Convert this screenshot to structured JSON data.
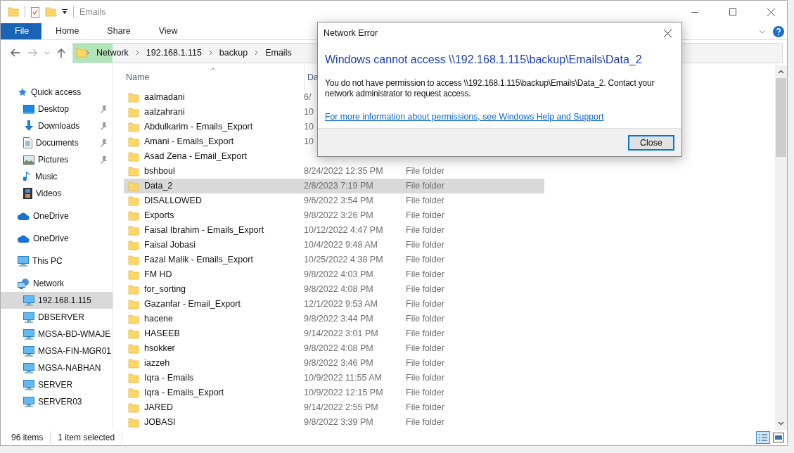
{
  "window": {
    "title": "Emails"
  },
  "ribbon": {
    "tabs": [
      {
        "label": "File",
        "selected": true
      },
      {
        "label": "Home",
        "selected": false
      },
      {
        "label": "Share",
        "selected": false
      },
      {
        "label": "View",
        "selected": false
      }
    ]
  },
  "address_bar": {
    "segments": [
      "Network",
      "192.168.1.115",
      "backup",
      "Emails"
    ]
  },
  "sidebar": {
    "items": [
      {
        "label": "Quick access",
        "kind": "star",
        "selected": false,
        "children": [
          {
            "label": "Desktop",
            "kind": "desktop",
            "pinned": true,
            "selected": false
          },
          {
            "label": "Downloads",
            "kind": "download",
            "pinned": true,
            "selected": false
          },
          {
            "label": "Documents",
            "kind": "document",
            "pinned": true,
            "selected": false
          },
          {
            "label": "Pictures",
            "kind": "pictures",
            "pinned": true,
            "selected": false
          },
          {
            "label": "Music",
            "kind": "music",
            "pinned": false,
            "selected": false
          },
          {
            "label": "Videos",
            "kind": "video",
            "pinned": false,
            "selected": false
          }
        ]
      },
      {
        "label": "OneDrive",
        "kind": "cloud",
        "selected": false
      },
      {
        "label": "OneDrive",
        "kind": "cloud",
        "selected": false
      },
      {
        "label": "This PC",
        "kind": "computer",
        "selected": false
      },
      {
        "label": "Network",
        "kind": "network",
        "selected": false,
        "children": [
          {
            "label": "192.168.1.115",
            "kind": "computer",
            "selected": true
          },
          {
            "label": "DBSERVER",
            "kind": "computer",
            "selected": false
          },
          {
            "label": "MGSA-BD-WMAJE",
            "kind": "computer",
            "selected": false
          },
          {
            "label": "MGSA-FIN-MGR01",
            "kind": "computer",
            "selected": false
          },
          {
            "label": "MGSA-NABHAN",
            "kind": "computer",
            "selected": false
          },
          {
            "label": "SERVER",
            "kind": "computer",
            "selected": false
          },
          {
            "label": "SERVER03",
            "kind": "computer",
            "selected": false
          }
        ]
      }
    ]
  },
  "file_list": {
    "columns": [
      "Name",
      "Da"
    ],
    "rows": [
      {
        "name": "aalmadani",
        "date": "6/",
        "selected": false
      },
      {
        "name": "aalzahrani",
        "date": "10",
        "selected": false
      },
      {
        "name": "Abdulkarim - Emails_Export",
        "date": "10",
        "selected": false
      },
      {
        "name": "Amani - Emails_Export",
        "date": "10",
        "selected": false
      },
      {
        "name": "Asad Zena - Email_Export",
        "selected": false
      },
      {
        "name": "bshboul",
        "date": "8/24/2022 12:35 PM",
        "type": "File folder",
        "selected": false
      },
      {
        "name": "Data_2",
        "date": "2/8/2023 7:19 PM",
        "type": "File folder",
        "selected": true
      },
      {
        "name": "DISALLOWED",
        "date": "9/6/2022 3:54 PM",
        "type": "File folder",
        "selected": false
      },
      {
        "name": "Exports",
        "date": "9/8/2022 3:26 PM",
        "type": "File folder",
        "selected": false
      },
      {
        "name": "Faisal Ibrahim - Emails_Export",
        "date": "10/12/2022 4:47 PM",
        "type": "File folder",
        "selected": false
      },
      {
        "name": "Faisal Jobasi",
        "date": "10/4/2022 9:48 AM",
        "type": "File folder",
        "selected": false
      },
      {
        "name": "Fazal Malik - Emails_Export",
        "date": "10/25/2022 4:38 PM",
        "type": "File folder",
        "selected": false
      },
      {
        "name": "FM HD",
        "date": "9/8/2022 4:03 PM",
        "type": "File folder",
        "selected": false
      },
      {
        "name": "for_sorting",
        "date": "9/8/2022 4:08 PM",
        "type": "File folder",
        "selected": false
      },
      {
        "name": "Gazanfar - Email_Export",
        "date": "12/1/2022 9:53 AM",
        "type": "File folder",
        "selected": false
      },
      {
        "name": "hacene",
        "date": "9/8/2022 3:44 PM",
        "type": "File folder",
        "selected": false
      },
      {
        "name": "HASEEB",
        "date": "9/14/2022 3:01 PM",
        "type": "File folder",
        "selected": false
      },
      {
        "name": "hsokker",
        "date": "9/8/2022 4:08 PM",
        "type": "File folder",
        "selected": false
      },
      {
        "name": "iazzeh",
        "date": "9/8/2022 3:46 PM",
        "type": "File folder",
        "selected": false
      },
      {
        "name": "Iqra - Emails",
        "date": "10/9/2022 11:55 AM",
        "type": "File folder",
        "selected": false
      },
      {
        "name": "Iqra - Emails_Export",
        "date": "10/9/2022 12:15 PM",
        "type": "File folder",
        "selected": false
      },
      {
        "name": "JARED",
        "date": "9/14/2022 2:55 PM",
        "type": "File folder",
        "selected": false
      },
      {
        "name": "JOBASI",
        "date": "9/8/2022 3:39 PM",
        "type": "File folder",
        "selected": false
      }
    ]
  },
  "status_bar": {
    "item_count": "96 items",
    "selection": "1 item selected"
  },
  "dialog": {
    "title": "Network Error",
    "heading": "Windows cannot access \\\\192.168.1.115\\backup\\Emails\\Data_2",
    "message": "You do not have permission to access \\\\192.168.1.115\\backup\\Emails\\Data_2. Contact your network administrator to request access.",
    "link": "For more information about permissions, see Windows Help and Support",
    "button": "Close"
  }
}
